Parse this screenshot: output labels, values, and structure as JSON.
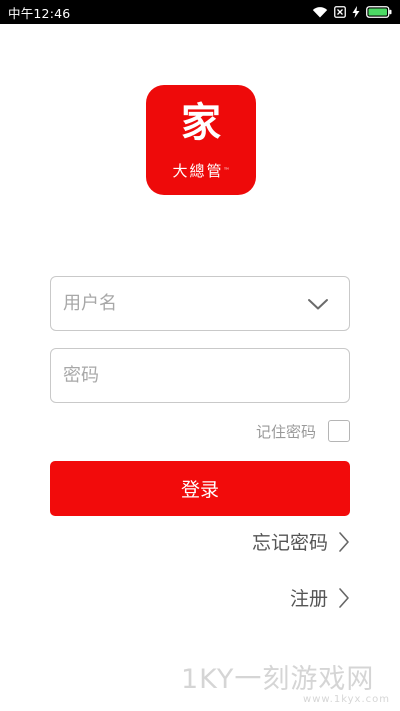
{
  "status_bar": {
    "time": "中午12:46",
    "icons": [
      "wifi-icon",
      "sim-x-icon",
      "charging-icon",
      "battery-icon"
    ],
    "battery_color": "#4cd964"
  },
  "logo": {
    "main_char": "家",
    "sub_text": "大總管",
    "tm": "™",
    "color": "#ee0a0a"
  },
  "form": {
    "username_placeholder": "用户名",
    "username_value": "",
    "password_placeholder": "密码",
    "password_value": "",
    "remember_label": "记住密码",
    "remember_checked": false,
    "login_label": "登录"
  },
  "links": {
    "forgot_password": "忘记密码",
    "register": "注册"
  },
  "watermark": {
    "text": "1KY一刻游戏网",
    "url": "www.1kyx.com"
  },
  "colors": {
    "accent": "#f20b0b",
    "border": "#c9c9c9",
    "placeholder": "#a8a8a8"
  }
}
